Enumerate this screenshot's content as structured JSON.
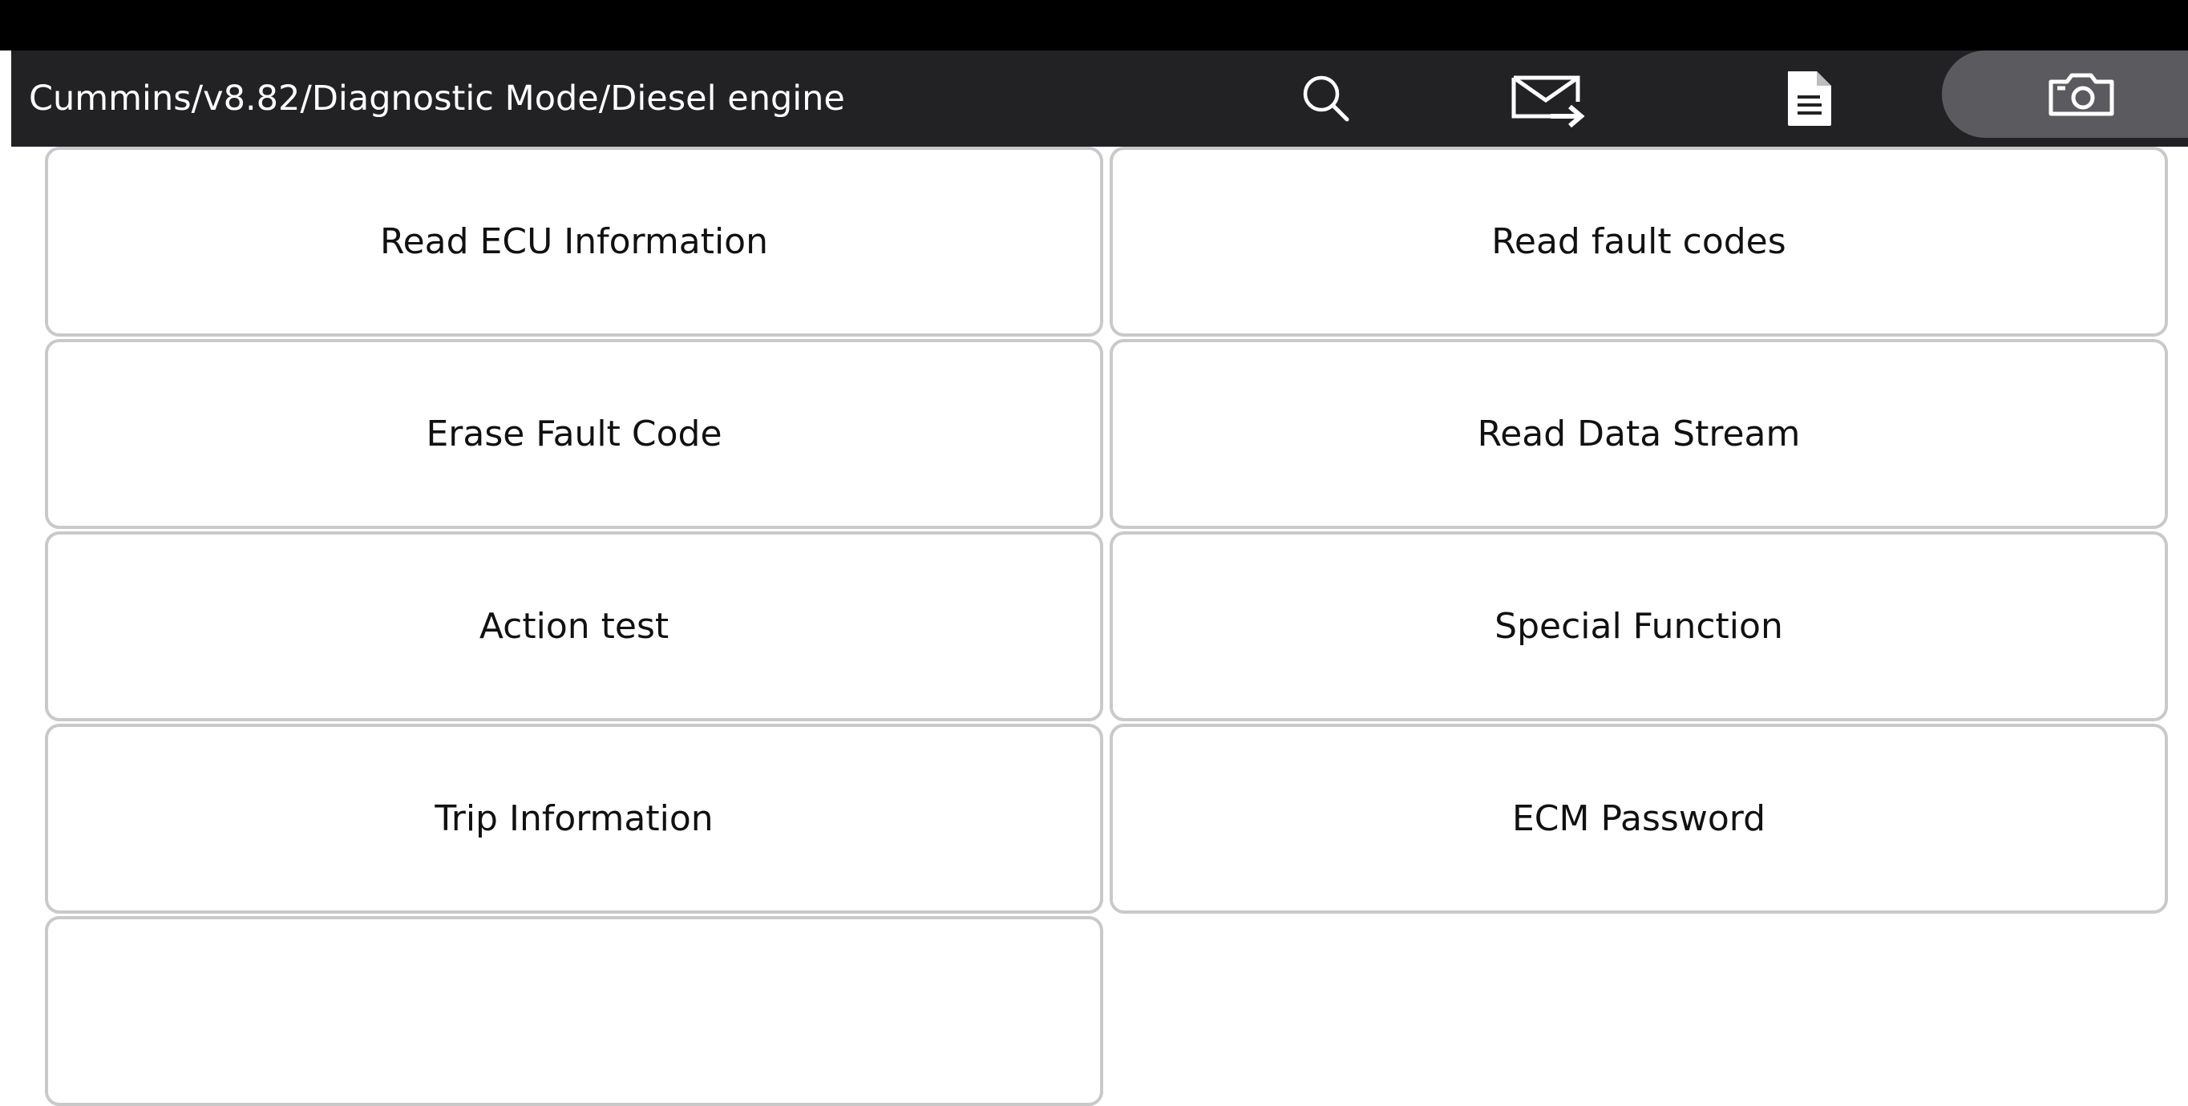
{
  "header": {
    "breadcrumb": "Cummins/v8.82/Diagnostic Mode/Diesel engine"
  },
  "toolbar": {
    "icons": [
      "search-icon",
      "mail-forward-icon",
      "document-icon",
      "camera-icon"
    ]
  },
  "menu": {
    "items": [
      {
        "label": "Read ECU Information"
      },
      {
        "label": "Read fault codes"
      },
      {
        "label": "Erase Fault Code"
      },
      {
        "label": "Read Data Stream"
      },
      {
        "label": "Action test"
      },
      {
        "label": "Special Function"
      },
      {
        "label": "Trip Information"
      },
      {
        "label": "ECM Password"
      },
      {
        "label": ""
      }
    ]
  },
  "colors": {
    "header_background": "#222225",
    "status_strip": "#000000",
    "camera_pill": "#5b5b5f",
    "button_border": "#c9c9c9"
  }
}
